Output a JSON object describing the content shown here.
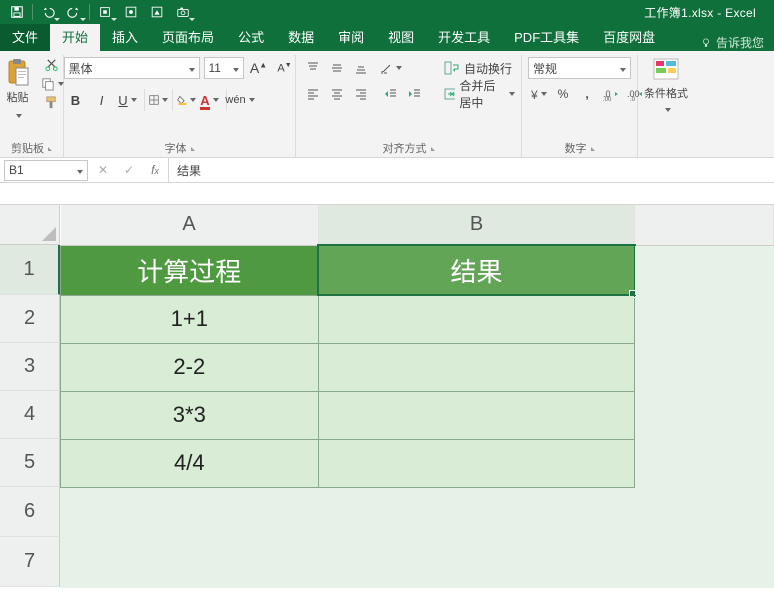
{
  "window": {
    "title": "工作簿1.xlsx - Excel"
  },
  "qat_icons": {
    "save": "save-icon",
    "undo": "undo-icon",
    "redo": "redo-icon",
    "touch": "touch-mode-icon",
    "ext1": "addin-icon",
    "ext2": "addin-icon",
    "camera": "camera-icon"
  },
  "tabs": {
    "file": "文件",
    "home": "开始",
    "insert": "插入",
    "page_layout": "页面布局",
    "formulas": "公式",
    "data": "数据",
    "review": "审阅",
    "view": "视图",
    "developer": "开发工具",
    "pdf": "PDF工具集",
    "baidu": "百度网盘",
    "tell_me": "告诉我您"
  },
  "ribbon": {
    "clipboard": {
      "paste": "粘贴",
      "label": "剪贴板"
    },
    "font": {
      "name": "黑体",
      "size": "11",
      "wen": "wén",
      "label": "字体"
    },
    "alignment": {
      "wrap": "自动换行",
      "merge": "合并后居中",
      "label": "对齐方式"
    },
    "number": {
      "format": "常规",
      "label": "数字"
    },
    "styles": {
      "cond_fmt": "条件格式",
      "label": ""
    }
  },
  "formula_bar": {
    "name_box": "B1",
    "value": "结果"
  },
  "sheet": {
    "columns": [
      "A",
      "B"
    ],
    "row_numbers": [
      "1",
      "2",
      "3",
      "4",
      "5",
      "6",
      "7"
    ],
    "headers": {
      "A": "计算过程",
      "B": "结果"
    },
    "rows": [
      {
        "A": "1+1",
        "B": ""
      },
      {
        "A": "2-2",
        "B": ""
      },
      {
        "A": "3*3",
        "B": ""
      },
      {
        "A": "4/4",
        "B": ""
      }
    ],
    "active_cell": "B1"
  }
}
